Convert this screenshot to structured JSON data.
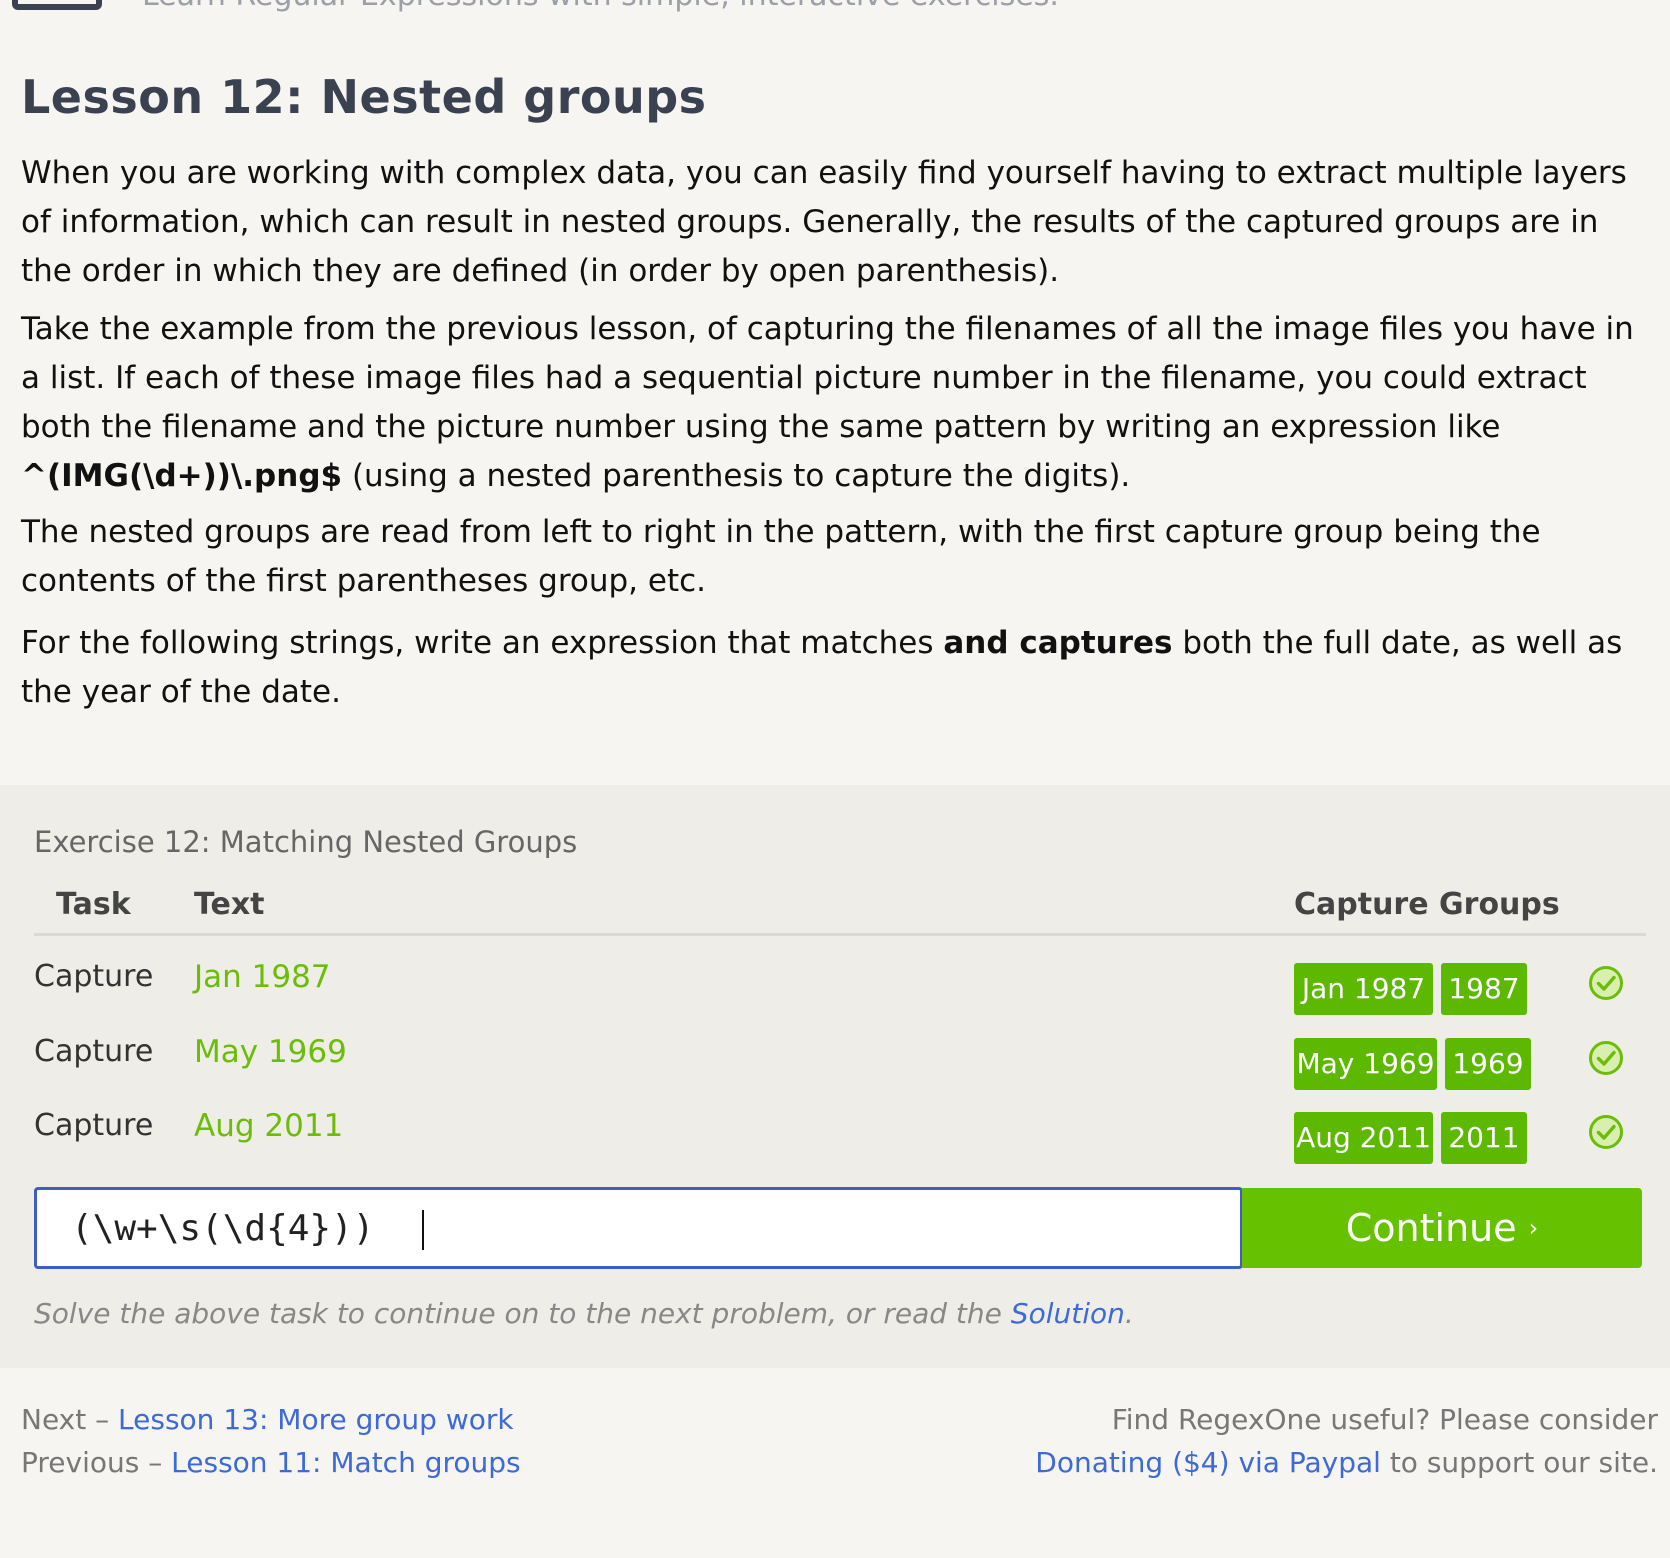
{
  "header": {
    "tagline": "Learn Regular Expressions with simple, interactive exercises."
  },
  "lesson": {
    "title": "Lesson 12: Nested groups",
    "p1": "When you are working with complex data, you can easily find yourself having to extract multiple layers of information, which can result in nested groups. Generally, the results of the captured groups are in the order in which they are defined (in order by open parenthesis).",
    "p2_before": "Take the example from the previous lesson, of capturing the filenames of all the image files you have in a list. If each of these image files had a sequential picture number in the filename, you could extract both the filename and the picture number using the same pattern by writing an expression like ",
    "p2_code": "^(IMG(\\d+))\\.png$",
    "p2_after": " (using a nested parenthesis to capture the digits).",
    "p3": "The nested groups are read from left to right in the pattern, with the first capture group being the contents of the first parentheses group, etc.",
    "p4_before": "For the following strings, write an expression that matches ",
    "p4_bold": "and captures",
    "p4_after": " both the full date, as well as the year of the date."
  },
  "exercise": {
    "title": "Exercise 12: Matching Nested Groups",
    "headers": {
      "task": "Task",
      "text": "Text",
      "groups": "Capture Groups"
    },
    "rows": [
      {
        "task": "Capture",
        "text": "Jan 1987",
        "groups": [
          "Jan 1987",
          "1987"
        ],
        "status": "check-icon"
      },
      {
        "task": "Capture",
        "text": "May 1969",
        "groups": [
          "May 1969",
          "1969"
        ],
        "status": "check-icon"
      },
      {
        "task": "Capture",
        "text": "Aug 2011",
        "groups": [
          "Aug 2011",
          "2011"
        ],
        "status": "check-icon"
      }
    ],
    "input_value": "(\\w+\\s(\\d{4}))",
    "continue_label": "Continue",
    "continue_arrow": "›",
    "hint_before": "Solve the above task to continue on to the next problem, or read the ",
    "hint_link": "Solution",
    "hint_after": "."
  },
  "footer": {
    "next_prefix": "Next – ",
    "next_link": "Lesson 13: More group work",
    "prev_prefix": "Previous – ",
    "prev_link": "Lesson 11: Match groups",
    "donate_line1": "Find RegexOne useful? Please consider",
    "donate_link": "Donating ($4) via Paypal",
    "donate_after": " to support our site."
  },
  "colors": {
    "accent_green": "#5cb800",
    "match_text": "#6bbd08",
    "link_blue": "#3d6ad6",
    "heading": "#3a4150"
  }
}
